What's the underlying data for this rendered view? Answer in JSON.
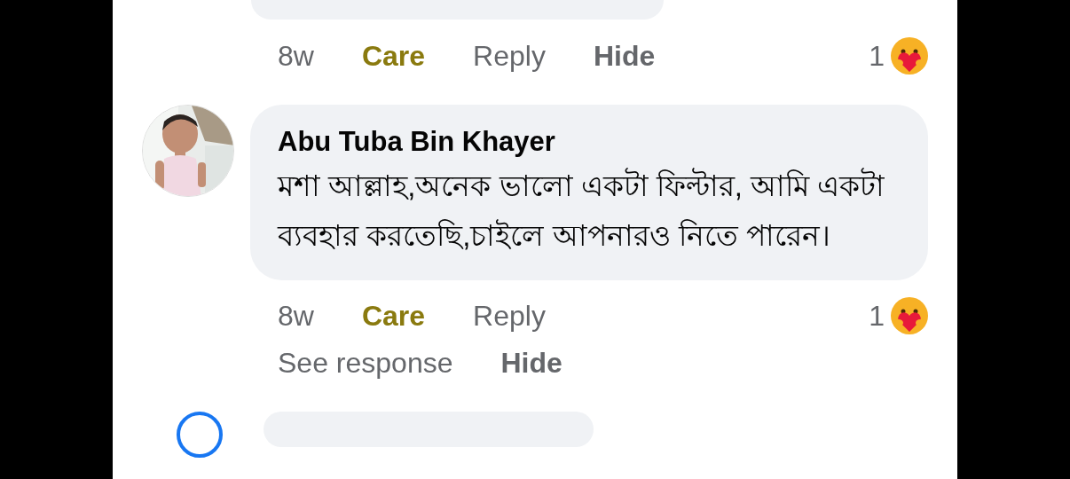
{
  "previous_comment": {
    "actions": [
      {
        "kind": "time",
        "label": "8w"
      },
      {
        "kind": "reaction",
        "label": "Care",
        "reacted": true
      },
      {
        "kind": "reply",
        "label": "Reply"
      },
      {
        "kind": "hide",
        "label": "Hide"
      }
    ],
    "reactions": {
      "count": "1",
      "kind": "care"
    }
  },
  "comment": {
    "author": "Abu Tuba Bin Khayer",
    "text": "মশা আল্লাহ,অনেক ভালো একটা ফিল্টার, আমি একটা ব্যবহার করতেছি,চাইলে আপনারও নিতে পারেন।",
    "actions": [
      {
        "kind": "time",
        "label": "8w"
      },
      {
        "kind": "reaction",
        "label": "Care",
        "reacted": true
      },
      {
        "kind": "reply",
        "label": "Reply"
      }
    ],
    "actions_second_line": [
      {
        "kind": "see_response",
        "label": "See response"
      },
      {
        "kind": "hide",
        "label": "Hide"
      }
    ],
    "reactions": {
      "count": "1",
      "kind": "care"
    }
  }
}
